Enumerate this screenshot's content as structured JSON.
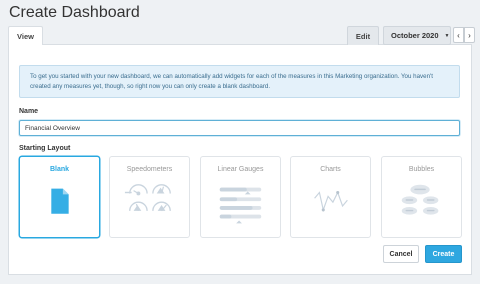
{
  "page": {
    "title": "Create Dashboard"
  },
  "tabs": {
    "view_label": "View",
    "edit_label": "Edit"
  },
  "date_selector": {
    "value": "October 2020",
    "prev_label": "‹",
    "next_label": "›"
  },
  "info": {
    "message": "To get you started with your new dashboard, we can automatically add widgets for each of the measures in this Marketing organization. You haven't created any measures yet, though, so right now you can only create a blank dashboard."
  },
  "form": {
    "name_label": "Name",
    "name_value": "Financial Overview",
    "layout_label": "Starting Layout"
  },
  "layouts": [
    {
      "label": "Blank",
      "icon": "document-icon",
      "selected": true
    },
    {
      "label": "Speedometers",
      "icon": "speedometer-icon",
      "selected": false
    },
    {
      "label": "Linear Gauges",
      "icon": "linear-gauge-icon",
      "selected": false
    },
    {
      "label": "Charts",
      "icon": "line-chart-icon",
      "selected": false
    },
    {
      "label": "Bubbles",
      "icon": "bubbles-icon",
      "selected": false
    }
  ],
  "actions": {
    "cancel_label": "Cancel",
    "create_label": "Create"
  },
  "colors": {
    "accent": "#2ea7e0",
    "info_bg": "#e4f1fa",
    "info_text": "#3a6d8e",
    "muted_icon": "#c9d4de"
  }
}
